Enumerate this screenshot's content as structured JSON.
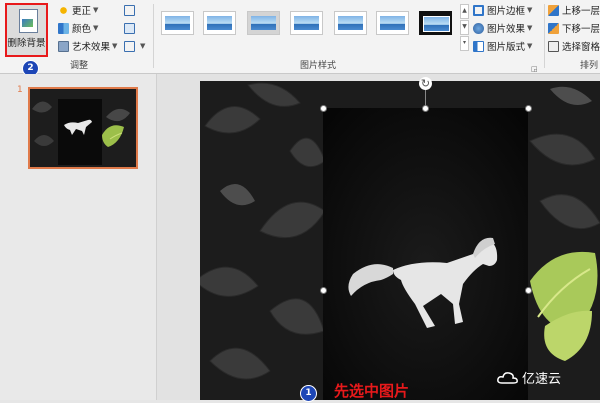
{
  "ribbon": {
    "adjust_group": {
      "remove_background_label": "删除背景",
      "corrections_label": "更正",
      "color_label": "颜色",
      "artistic_effects_label": "艺术效果",
      "group_label": "调整"
    },
    "styles_group": {
      "group_label": "图片样式",
      "border_label": "图片边框",
      "effects_label": "图片效果",
      "layout_label": "图片版式"
    },
    "arrange_group": {
      "bring_forward_label": "上移一层",
      "send_backward_label": "下移一层",
      "selection_pane_label": "选择窗格",
      "group_label": "排列"
    }
  },
  "annotations": {
    "step1_number": "1",
    "step1_caption": "先选中图片",
    "step2_number": "2"
  },
  "slide_panel": {
    "slide_number": "1"
  },
  "watermark": {
    "text": "亿速云"
  },
  "colors": {
    "annotation_red": "#e8191b",
    "badge_blue": "#1d46b6",
    "selected_slide_border": "#e07a4a"
  }
}
